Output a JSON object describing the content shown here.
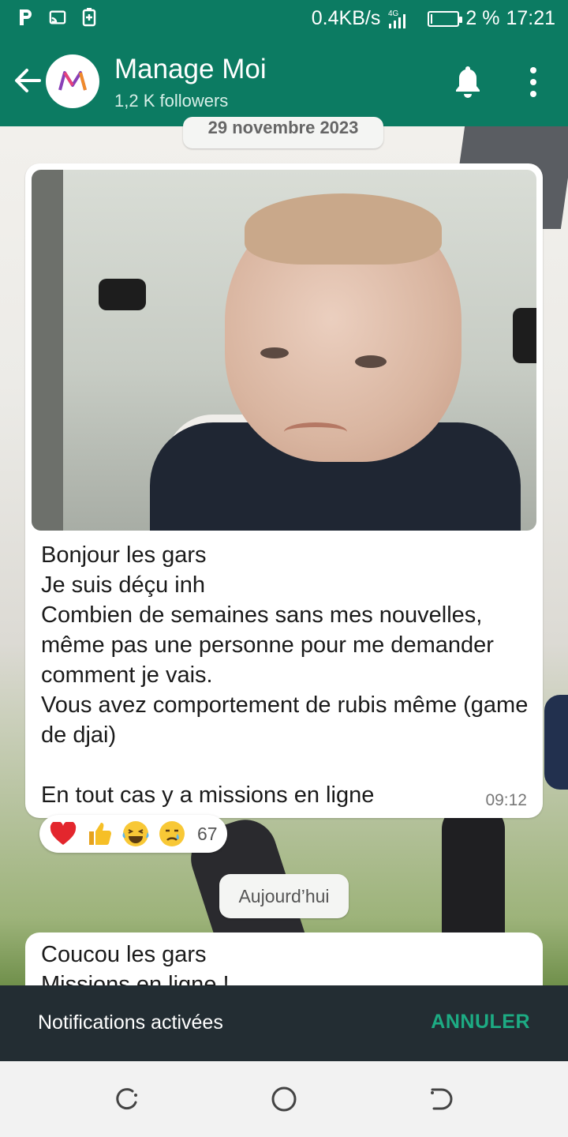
{
  "status_bar": {
    "network_speed": "0.4KB/s",
    "network_type": "4G",
    "battery_percent": "2 %",
    "battery_level": 0.02,
    "time": "17:21",
    "left_icons": [
      "p-icon",
      "cast-icon",
      "battery-saver-icon"
    ]
  },
  "header": {
    "channel_name": "Manage Moi",
    "followers": "1,2 K followers",
    "avatar_icon": "manage-moi-logo",
    "back_icon": "arrow-left-icon",
    "bell_icon": "bell-icon",
    "menu_icon": "more-vertical-icon"
  },
  "messages": [
    {
      "date_label": "29 novembre 2023",
      "image_description_icon": "sad-baby-photo",
      "text": "Bonjour les gars\nJe suis déçu inh\nCombien de semaines sans mes nouvelles, même pas une personne pour me demander comment je vais.\nVous avez comportement de rubis même (game de djai)\n\nEn tout cas y a missions en ligne",
      "time": "09:12",
      "reactions": {
        "emojis": [
          "❤️",
          "👍",
          "😂",
          "😢"
        ],
        "count": "67"
      }
    },
    {
      "date_label": "Aujourd’hui",
      "line1": "Coucou les gars",
      "line2": "Missions en ligne !"
    }
  ],
  "snackbar": {
    "text": "Notifications activées",
    "action": "ANNULER"
  },
  "nav_bar": {
    "icons": [
      "recents-icon",
      "home-icon",
      "back-icon"
    ]
  },
  "colors": {
    "header_green": "#0c7b62",
    "snackbar_bg": "#232d33",
    "snackbar_action": "#1dab83"
  }
}
